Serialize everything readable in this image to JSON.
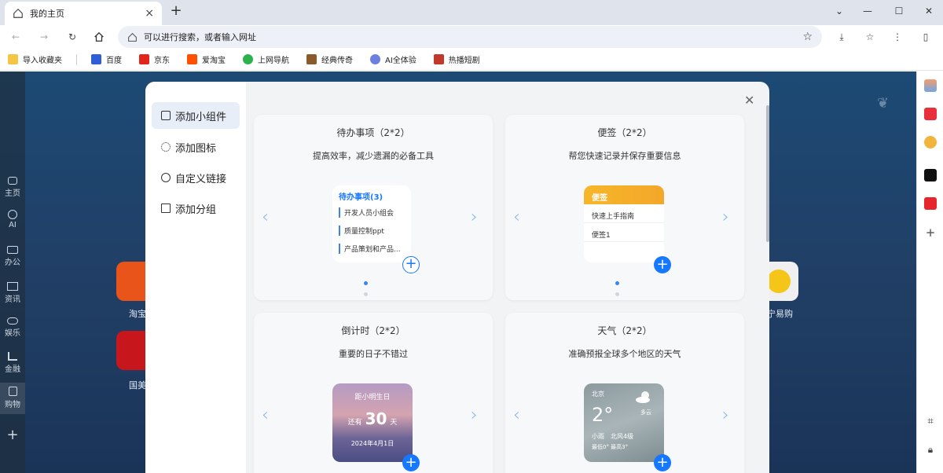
{
  "browser": {
    "tab_title": "我的主页",
    "new_tab_label": "+",
    "address_placeholder": "可以进行搜索，或者输入网址"
  },
  "bookmarks": [
    {
      "label": "导入收藏夹",
      "color": "#f4c542"
    },
    {
      "label": "百度",
      "color": "#2f5fd6"
    },
    {
      "label": "京东",
      "color": "#e1251b"
    },
    {
      "label": "爱淘宝",
      "color": "#ff5000"
    },
    {
      "label": "上网导航",
      "color": "#2bb24c"
    },
    {
      "label": "经典传奇",
      "color": "#8a5a2b"
    },
    {
      "label": "AI全体验",
      "color": "#6b7fe0"
    },
    {
      "label": "热播短剧",
      "color": "#c0392b"
    }
  ],
  "leftnav": [
    {
      "label": "主页"
    },
    {
      "label": "AI"
    },
    {
      "label": "办公"
    },
    {
      "label": "资讯"
    },
    {
      "label": "娱乐"
    },
    {
      "label": "金融"
    },
    {
      "label": "购物"
    }
  ],
  "background_apps": {
    "taobao_label": "淘宝",
    "guomei_label": "国美",
    "suning_label": "宁易购"
  },
  "modal": {
    "menu": [
      {
        "label": "添加小组件"
      },
      {
        "label": "添加图标"
      },
      {
        "label": "自定义链接"
      },
      {
        "label": "添加分组"
      }
    ],
    "cards": {
      "todo": {
        "title": "待办事项（2*2）",
        "desc": "提高效率，减少遗漏的必备工具",
        "preview_header": "待办事项(3)",
        "items": [
          "开发人员小组会",
          "质量控制ppt",
          "产品策划和产品..."
        ]
      },
      "note": {
        "title": "便签（2*2）",
        "desc": "帮您快速记录并保存重要信息",
        "preview_header": "便签",
        "items": [
          "快速上手指南",
          "便签1"
        ]
      },
      "countdown": {
        "title": "倒计时（2*2）",
        "desc": "重要的日子不错过",
        "line1": "距小明生日",
        "prefix": "还有",
        "days": "30",
        "suffix": "天",
        "date": "2024年4月1日"
      },
      "weather": {
        "title": "天气（2*2）",
        "desc": "准确预报全球多个地区的天气",
        "city": "北京",
        "temp": "2°",
        "condition": "多云",
        "wind": "小雨　北风4级",
        "range": "最低0° 最高3°"
      }
    }
  }
}
